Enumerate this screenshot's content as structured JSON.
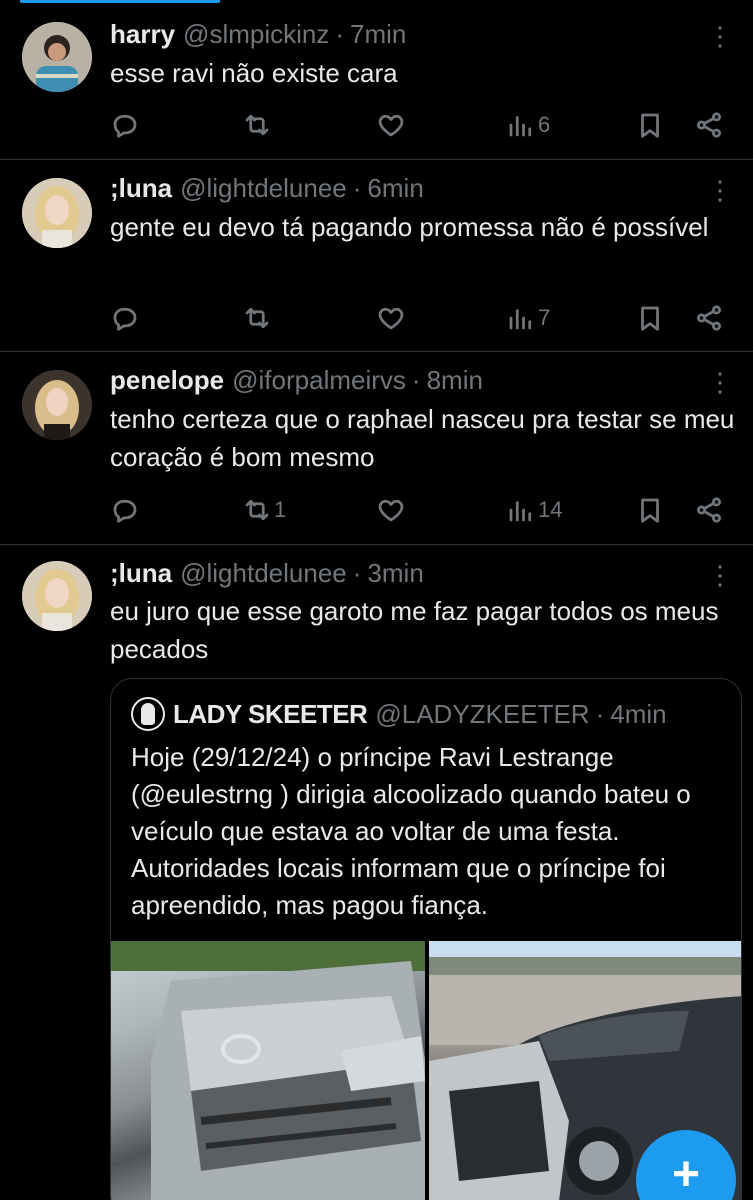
{
  "posts": [
    {
      "name": "harry",
      "handle": "@slmpickinz",
      "separator": "·",
      "time": "7min",
      "text": "esse ravi não existe cara",
      "views": "6",
      "retweets": ""
    },
    {
      "name": ";luna",
      "handle": "@lightdelunee",
      "separator": "·",
      "time": "6min",
      "text": "gente eu devo tá pagando promessa não é possível",
      "views": "7",
      "retweets": ""
    },
    {
      "name": "penelope",
      "handle": "@iforpalmeirvs",
      "separator": "·",
      "time": "8min",
      "text": "tenho certeza que o raphael nasceu pra testar se meu coração é bom mesmo",
      "views": "14",
      "retweets": "1"
    },
    {
      "name": ";luna",
      "handle": "@lightdelunee",
      "separator": "·",
      "time": "3min",
      "text": "eu juro que esse garoto me faz pagar todos os meus pecados"
    }
  ],
  "quote": {
    "name": "LADY SKEETER",
    "handle": "@LADYZKEETER",
    "separator": "·",
    "time": "4min",
    "text": "Hoje (29/12/24) o príncipe Ravi Lestrange (@eulestrng )  dirigia alcoolizado quando bateu o veículo que estava ao voltar de uma festa. Autoridades locais informam que o príncipe foi apreendido, mas pagou fiança."
  },
  "icons": {
    "more": "more-vertical-icon",
    "reply": "reply-icon",
    "retweet": "retweet-icon",
    "like": "heart-icon",
    "views": "views-icon",
    "bookmark": "bookmark-icon",
    "share": "share-icon",
    "compose": "plus-icon"
  },
  "colors": {
    "background": "#000000",
    "accent": "#1d9bf0",
    "text_primary": "#e7e9ea",
    "text_secondary": "#71767b",
    "divider": "#2f3336"
  }
}
